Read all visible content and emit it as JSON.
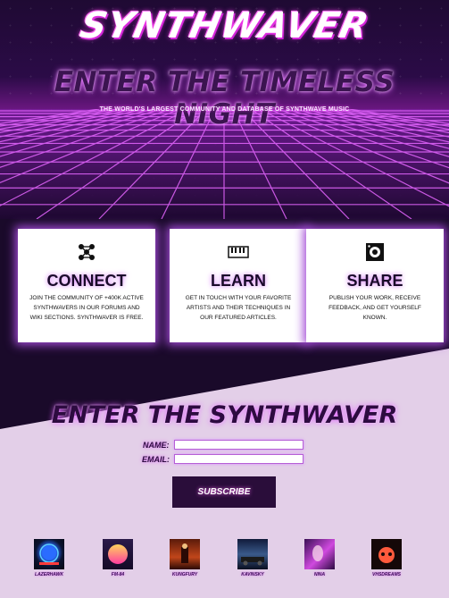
{
  "site": {
    "logo": "SYNTHWAVER",
    "tagline": "ENTER THE TIMELESS NIGHT",
    "subtagline": "THE WORLD'S LARGEST COMMUNITY AND DATABASE OF SYNTHWAVE MUSIC"
  },
  "cards": [
    {
      "title": "CONNECT",
      "icon": "network-icon",
      "text": "JOIN THE COMMUNITY OF +400K ACTIVE SYNTHWAVERS IN OUR FORUMS AND WIKI SECTIONS. SYNTHWAVER IS FREE."
    },
    {
      "title": "LEARN",
      "icon": "keyboard-icon",
      "text": "GET IN TOUCH WITH YOUR FAVORITE ARTISTS AND THEIR TECHNIQUES IN OUR FEATURED ARTICLES."
    },
    {
      "title": "SHARE",
      "icon": "speaker-icon",
      "text": "PUBLISH YOUR WORK, RECEIVE FEEDBACK, AND GET YOURSELF KNOWN."
    }
  ],
  "signup": {
    "title": "ENTER THE SYNTHWAVER",
    "name_label": "NAME:",
    "email_label": "EMAIL:",
    "name_value": "",
    "email_value": "",
    "button": "SUBSCRIBE"
  },
  "artists": [
    {
      "name": "LAZERHAWK"
    },
    {
      "name": "FM-84"
    },
    {
      "name": "KUNGFURY"
    },
    {
      "name": "KAVINSKY"
    },
    {
      "name": "NINA"
    },
    {
      "name": "VHSDREAMS"
    }
  ],
  "colors": {
    "accent": "#e05cff",
    "dark": "#2a0d3a",
    "light_bg": "#e3cfe8"
  }
}
